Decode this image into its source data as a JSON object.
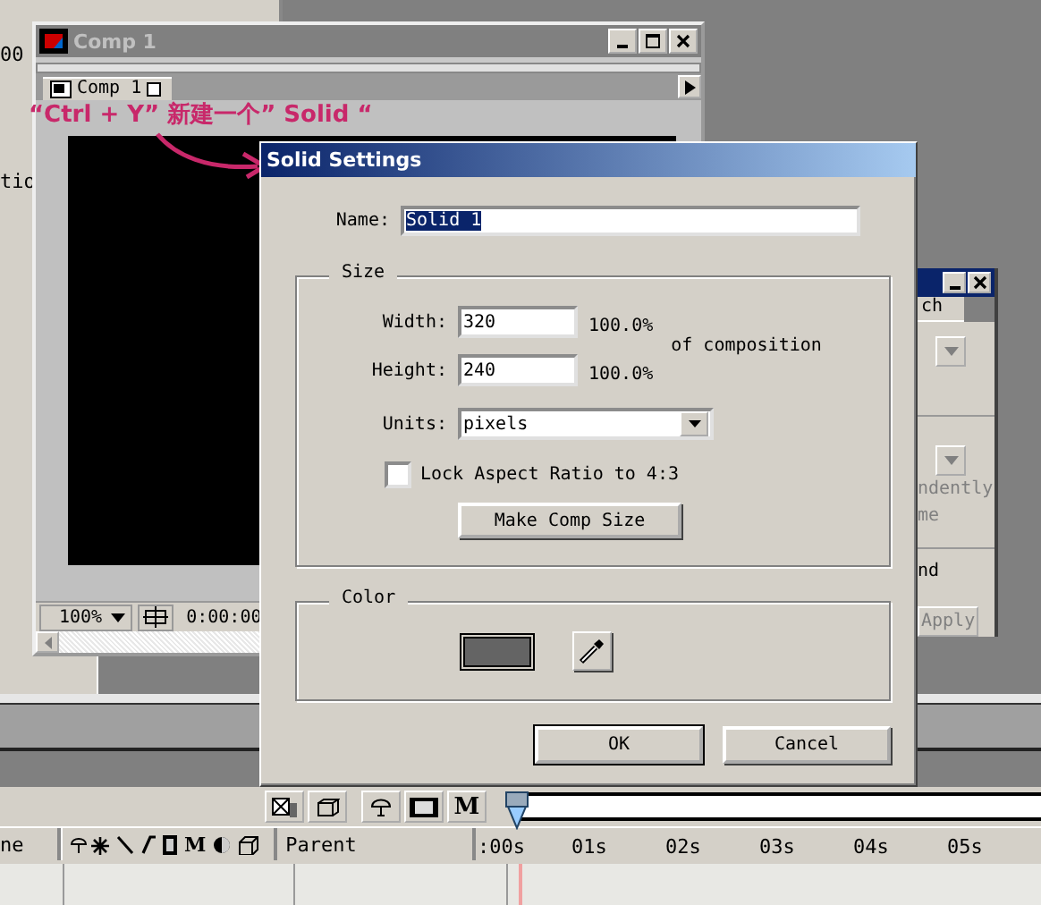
{
  "left_panel": {
    "texts": [
      "00",
      "tio"
    ]
  },
  "comp_window": {
    "title": "Comp 1",
    "active": false,
    "tab": "Comp 1",
    "zoom": "100%",
    "timecode": "0:00:00"
  },
  "annotation": {
    "text": "“Ctrl + Y” 新建一个” Solid “"
  },
  "dialog": {
    "title": "Solid Settings",
    "name_label": "Name:",
    "name_value": "Solid 1",
    "name_selected": true,
    "size": {
      "legend": "Size",
      "width_label": "Width:",
      "width_value": "320",
      "width_percent": "100.0%",
      "height_label": "Height:",
      "height_value": "240",
      "height_percent": "100.0%",
      "of_composition": "of composition",
      "units_label": "Units:",
      "units_value": "pixels",
      "lock_label": "Lock Aspect Ratio to 4:3",
      "lock_checked": false,
      "make_comp_size": "Make Comp Size"
    },
    "color": {
      "legend": "Color"
    },
    "buttons": [
      {
        "label": "OK",
        "default": true
      },
      {
        "label": "Cancel",
        "default": false
      }
    ]
  },
  "right_panel": {
    "tab": "ch",
    "texts": [
      {
        "text": "ndently",
        "disabled": true
      },
      {
        "text": "me",
        "disabled": true
      },
      {
        "text": "nd",
        "disabled": false
      }
    ],
    "apply": {
      "label": "Apply",
      "disabled": true
    }
  },
  "timeline": {
    "toolbar_label": "M",
    "name_header": "ne",
    "switch_label": "M",
    "parent_header": "Parent",
    "ruler": [
      ":00s",
      "01s",
      "02s",
      "03s",
      "04s",
      "05s"
    ]
  }
}
